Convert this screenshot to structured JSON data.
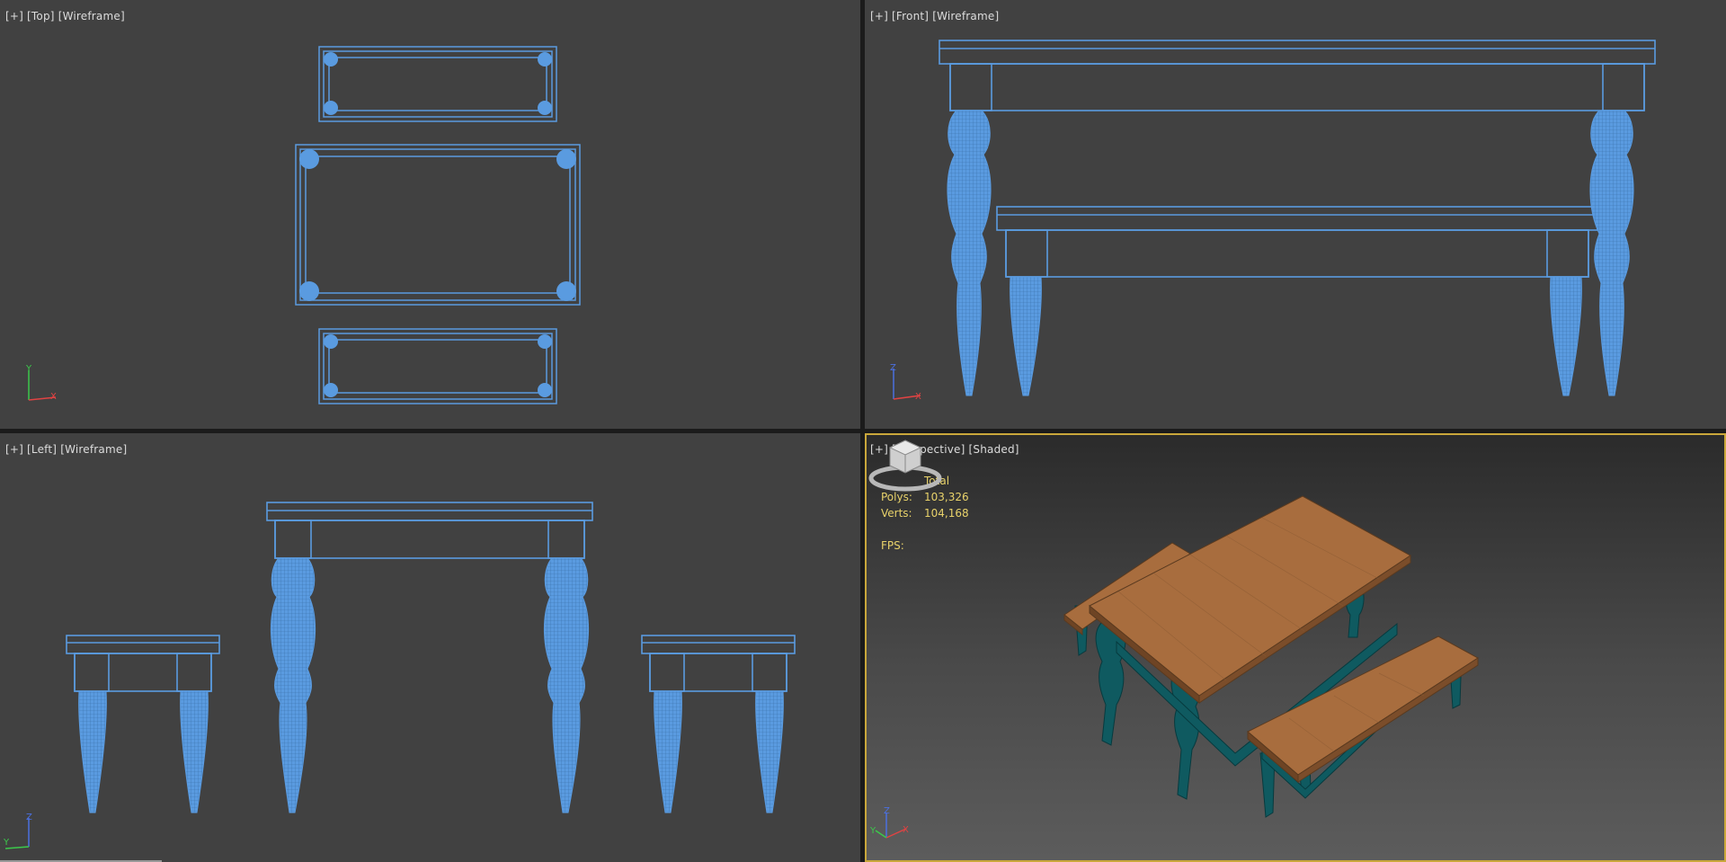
{
  "viewports": {
    "top": {
      "plus": "[+]",
      "view": "[Top]",
      "mode": "[Wireframe]"
    },
    "front": {
      "plus": "[+]",
      "view": "[Front]",
      "mode": "[Wireframe]"
    },
    "left": {
      "plus": "[+]",
      "view": "[Left]",
      "mode": "[Wireframe]"
    },
    "perspective": {
      "plus": "[+]",
      "view": "[Perspective]",
      "mode": "[Shaded]"
    }
  },
  "stats": {
    "header": "Total",
    "polys_label": "Polys:",
    "polys_value": "103,326",
    "verts_label": "Verts:",
    "verts_value": "104,168",
    "fps_label": "FPS:"
  },
  "axes": {
    "top": [
      "Y",
      "X"
    ],
    "front": [
      "Z",
      "X"
    ],
    "left": [
      "Z",
      "Y"
    ],
    "perspective": [
      "Z",
      "X",
      "Y"
    ]
  },
  "colors": {
    "wireframe": "#5a9be0",
    "viewport_bg": "#414141",
    "active_border": "#c9a73b",
    "stats_text": "#e8d26a",
    "wood": "#a86d3e",
    "legs": "#0f5a60"
  },
  "icons": {
    "viewcube": "viewcube-icon",
    "axis": "axis-tripod-icon"
  }
}
